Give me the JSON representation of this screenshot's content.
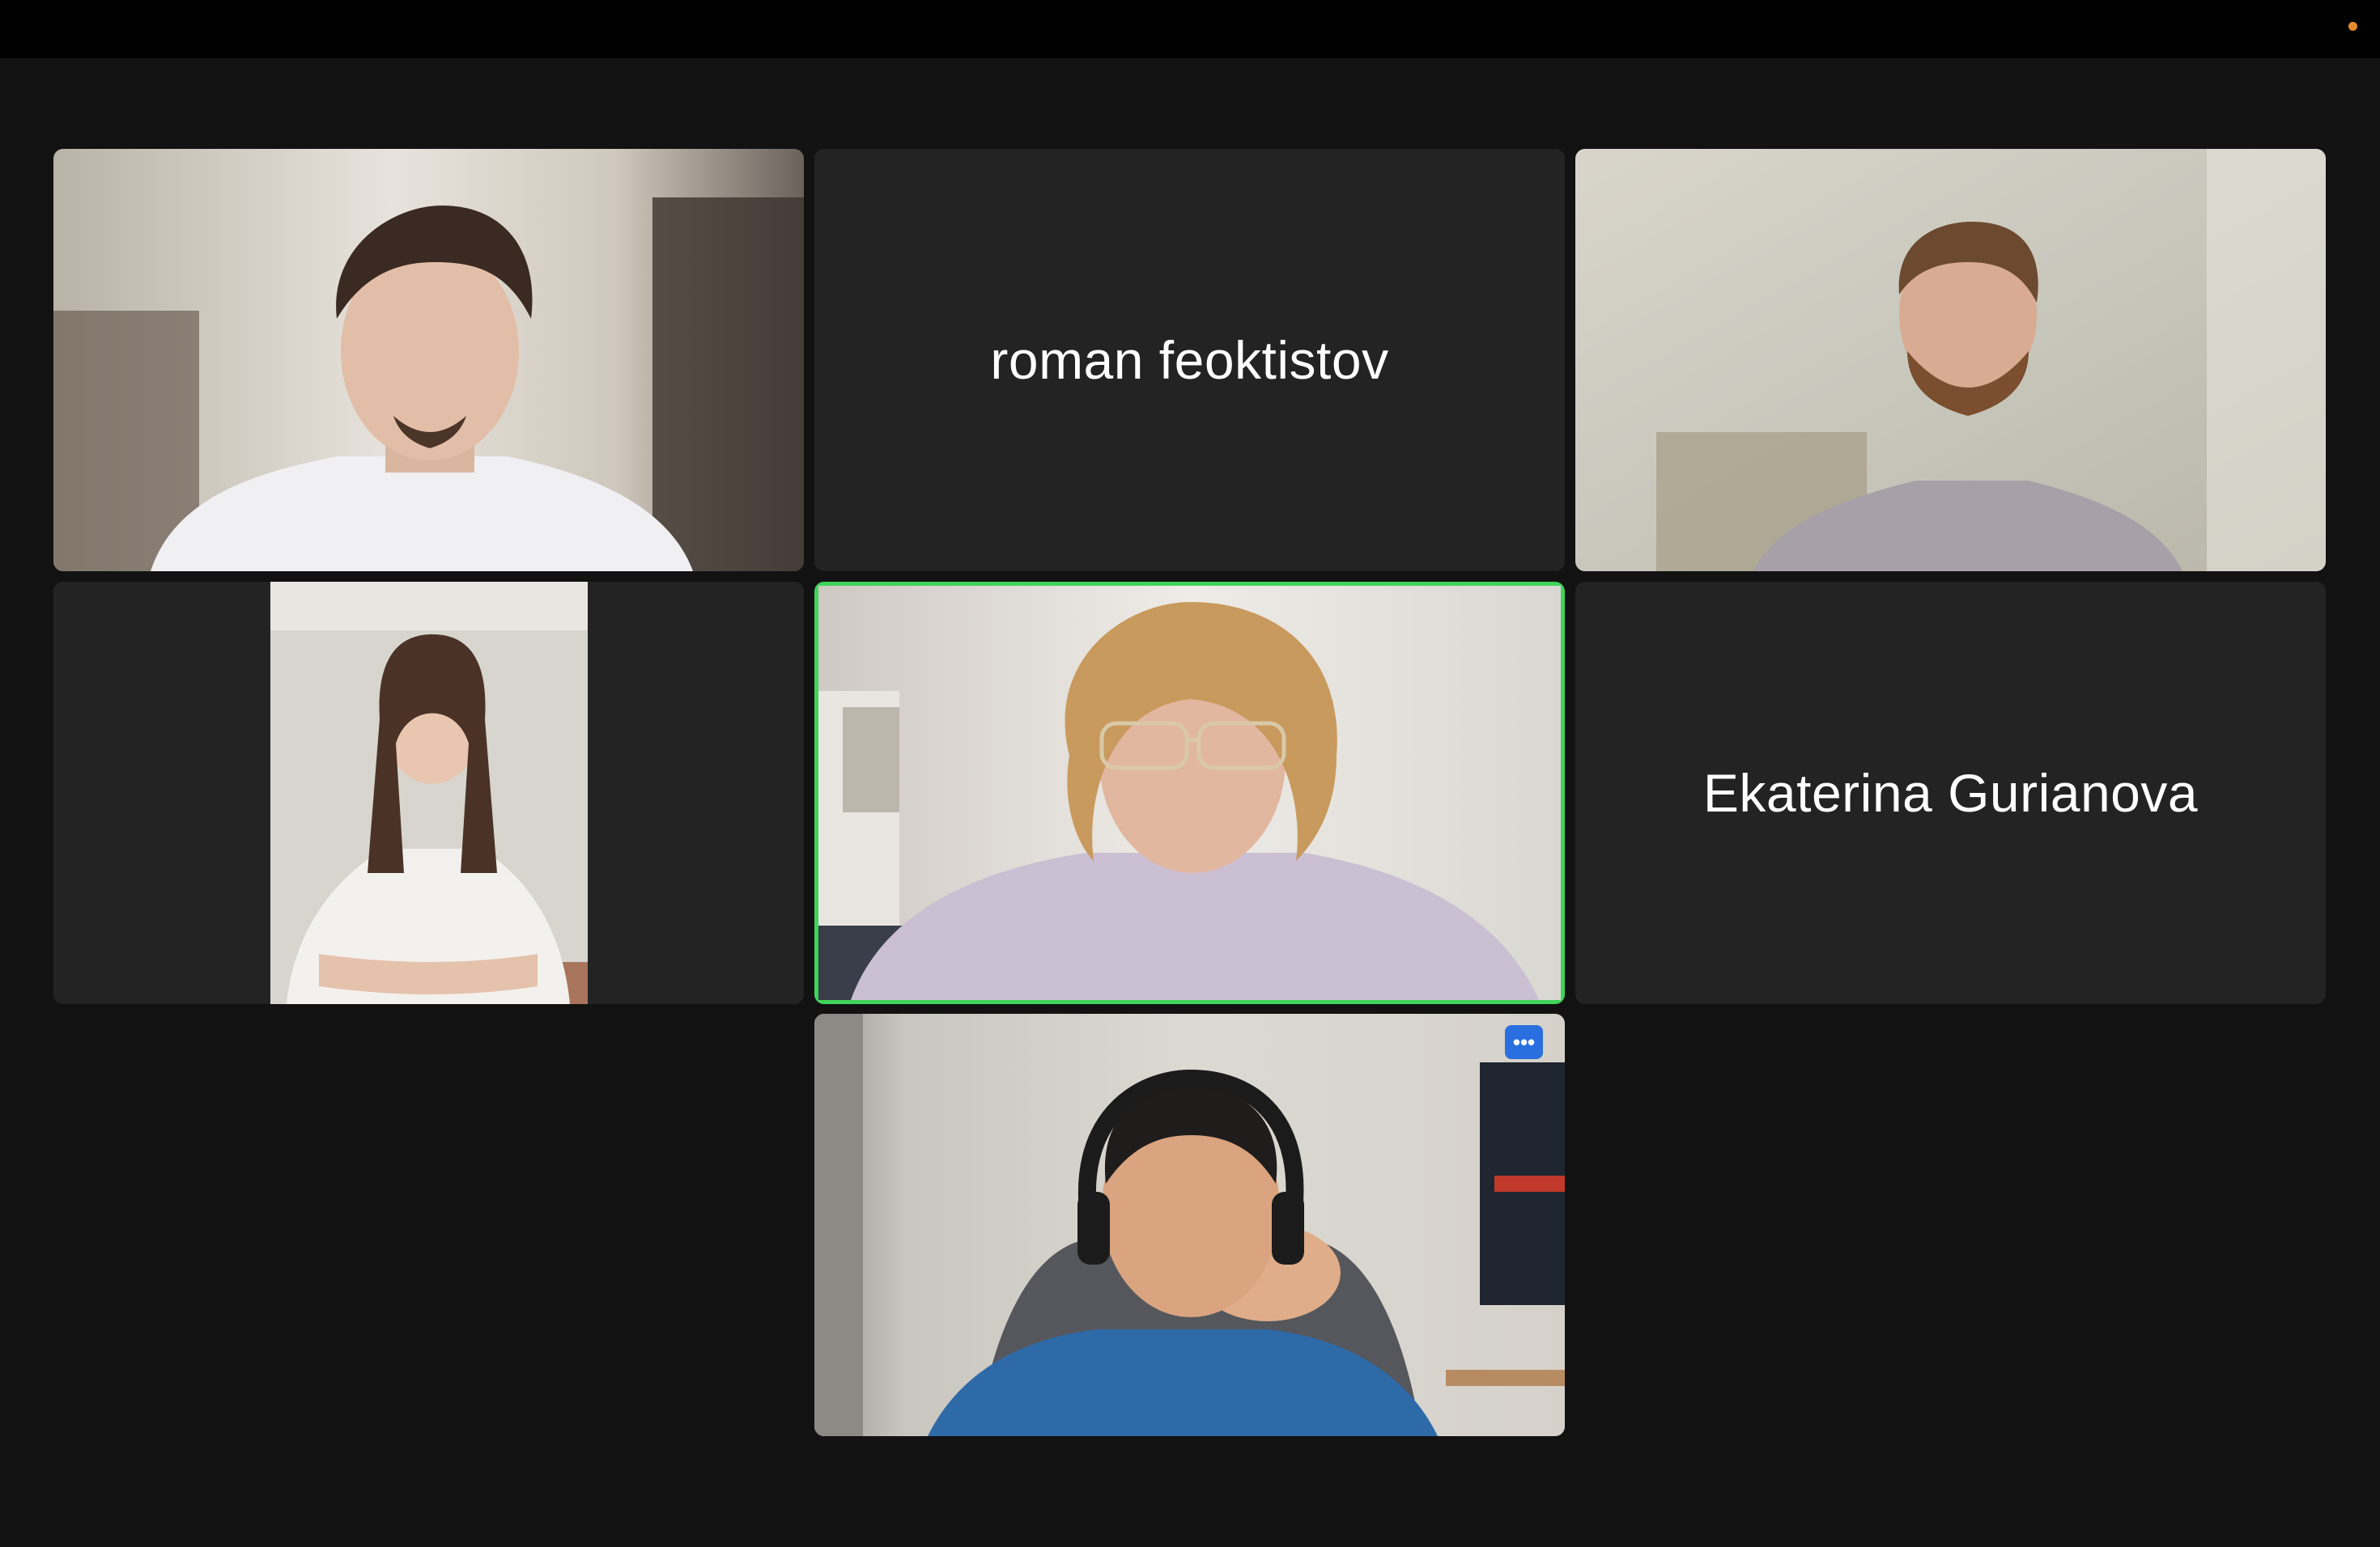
{
  "window": {
    "status_dot_color": "#e58a2c"
  },
  "gallery": {
    "participants": [
      {
        "name": "",
        "video": "on",
        "icon": "participant-video"
      },
      {
        "name": "roman feoktistov",
        "video": "off"
      },
      {
        "name": "",
        "video": "on",
        "icon": "participant-video"
      },
      {
        "name": "",
        "video": "on",
        "icon": "participant-video-portrait"
      },
      {
        "name": "",
        "video": "on",
        "active_speaker": true,
        "highlight_color": "#3fd45a",
        "icon": "participant-video"
      },
      {
        "name": "Ekaterina Gurianova",
        "video": "off"
      },
      {
        "name": "",
        "video": "on",
        "icon": "participant-video",
        "more_options_label": "•••"
      }
    ]
  }
}
